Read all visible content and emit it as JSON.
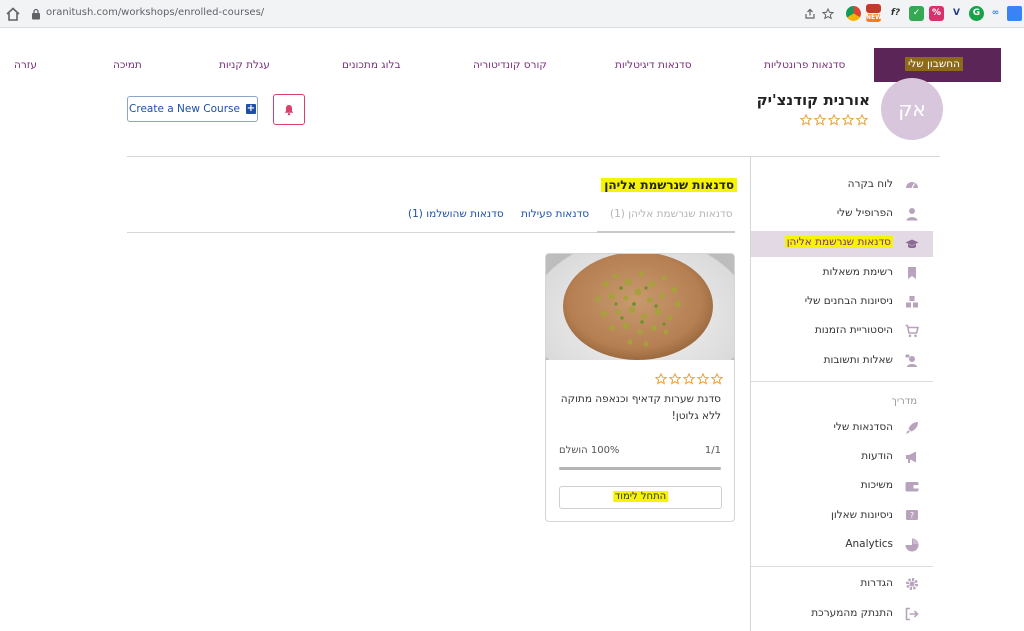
{
  "browser": {
    "url": "oranitush.com/workshops/enrolled-courses/"
  },
  "topnav": {
    "account": "החשבון שלי",
    "items": [
      "סדנאות פרונטליות",
      "סדנאות דיגיטליות",
      "קורס קונדיטוריה",
      "בלוג מתכונים",
      "עגלת קניות",
      "תמיכה",
      "עזרה"
    ]
  },
  "profile": {
    "avatar_initials": "אק",
    "name": "אורנית קודנצ'יק",
    "rating_stars": 5
  },
  "header_actions": {
    "create_course": "Create a New Course",
    "bell_icon": "bell-icon"
  },
  "sidebar": {
    "items": [
      {
        "label": "לוח בקרה",
        "icon": "dashboard-icon"
      },
      {
        "label": "הפרופיל שלי",
        "icon": "user-icon"
      },
      {
        "label": "סדנאות שנרשמת אליהן",
        "icon": "graduation-cap-icon"
      },
      {
        "label": "רשימת משאלות",
        "icon": "bookmark-icon"
      },
      {
        "label": "ניסיונות הבחנים שלי",
        "icon": "cubes-icon"
      },
      {
        "label": "היסטוריית הזמנות",
        "icon": "cart-icon"
      },
      {
        "label": "שאלות ותשובות",
        "icon": "qa-icon"
      }
    ],
    "instructor_heading": "מדריך",
    "instructor_items": [
      {
        "label": "הסדנאות שלי",
        "icon": "rocket-icon"
      },
      {
        "label": "הודעות",
        "icon": "megaphone-icon"
      },
      {
        "label": "משיכות",
        "icon": "wallet-icon"
      },
      {
        "label": "ניסיונות שאלון",
        "icon": "quiz-icon"
      },
      {
        "label": "Analytics",
        "icon": "pie-chart-icon"
      }
    ],
    "bottom_items": [
      {
        "label": "הגדרות",
        "icon": "gear-icon"
      },
      {
        "label": "התנתק מהמערכת",
        "icon": "logout-icon"
      }
    ]
  },
  "content": {
    "title": "סדנאות שנרשמת אליהן",
    "tabs": [
      "סדנאות שנרשמת אליהן (1)",
      "סדנאות פעילות",
      "סדנאות שהושלמו (1)"
    ]
  },
  "course_card": {
    "title": "סדנת שערות קדאיף וכנאפה מתוקה ללא גלוטן!",
    "rating_stars": 5,
    "progress_count": "1/1",
    "progress_label": "100% הושלם",
    "progress_fraction": 1.0,
    "start_button": "התחל לימוד"
  },
  "colors": {
    "brand_purple": "#5c2558",
    "nav_text": "#7b2f7b",
    "highlight": "#f6f400",
    "star": "#e8a13a",
    "link_blue": "#1d4fa8"
  }
}
